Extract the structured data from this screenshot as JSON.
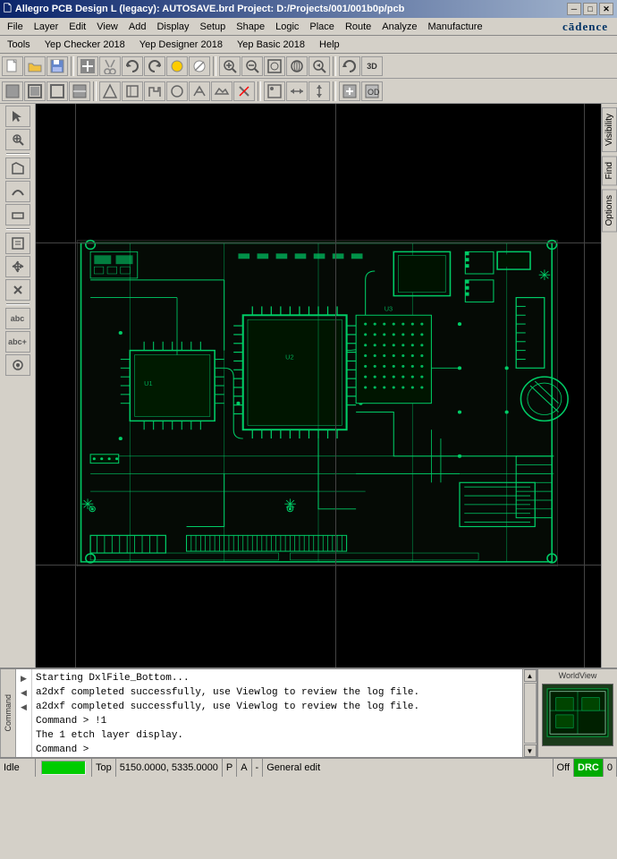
{
  "titlebar": {
    "icon": "📋",
    "title": "Allegro PCB Design L (legacy): AUTOSAVE.brd  Project: D:/Projects/001/001b0p/pcb",
    "min_btn": "─",
    "max_btn": "□",
    "close_btn": "✕"
  },
  "menubar": {
    "items": [
      "File",
      "Layer",
      "Edit",
      "View",
      "Add",
      "Display",
      "Setup",
      "Shape",
      "Logic",
      "Place",
      "Route",
      "Analyze",
      "Manufacture"
    ]
  },
  "toolsbar": {
    "items": [
      "Tools",
      "Yep Checker 2018",
      "Yep Designer 2018",
      "Yep Basic 2018",
      "Help"
    ]
  },
  "cadence_logo": "cādence",
  "statusbar": {
    "idle": "Idle",
    "view": "Top",
    "coords": "5150.0000, 5335.0000",
    "pa": "P",
    "a": "A",
    "dash": "-",
    "general_edit": "General edit",
    "off": "Off",
    "drc": "DRC",
    "num": "0"
  },
  "right_tabs": {
    "visibility": "Visibility",
    "find": "Find",
    "options": "Options"
  },
  "worldview_label": "WorldView",
  "log": {
    "lines": [
      "Starting DxlFile_Bottom...",
      "a2dxf completed successfully, use Viewlog to review the log file.",
      "a2dxf completed successfully, use Viewlog to review the log file.",
      "Command > !1",
      "The 1 etch layer display.",
      "Command >"
    ]
  },
  "log_side_label": "Command",
  "toolbar1": {
    "buttons": [
      "📂",
      "💾",
      "✂",
      "↩",
      "↪",
      "⟳",
      "▶",
      "⏸",
      "🔍",
      "🔍",
      "🔍",
      "🔍",
      "🔍",
      "⊕",
      "⊗",
      "↻",
      "⬜",
      "3D"
    ]
  },
  "toolbar2": {
    "buttons": [
      "▣",
      "▣",
      "▣",
      "▣",
      "▣",
      "▣",
      "▣",
      "▣",
      "▣",
      "▣",
      "▣",
      "▣",
      "▣",
      "▣",
      "▣",
      "▣",
      "▣",
      "⊞",
      "⊡"
    ]
  },
  "left_panel_buttons": [
    "↖",
    "✚",
    "✚",
    "abc",
    "abc+",
    "⊕"
  ]
}
